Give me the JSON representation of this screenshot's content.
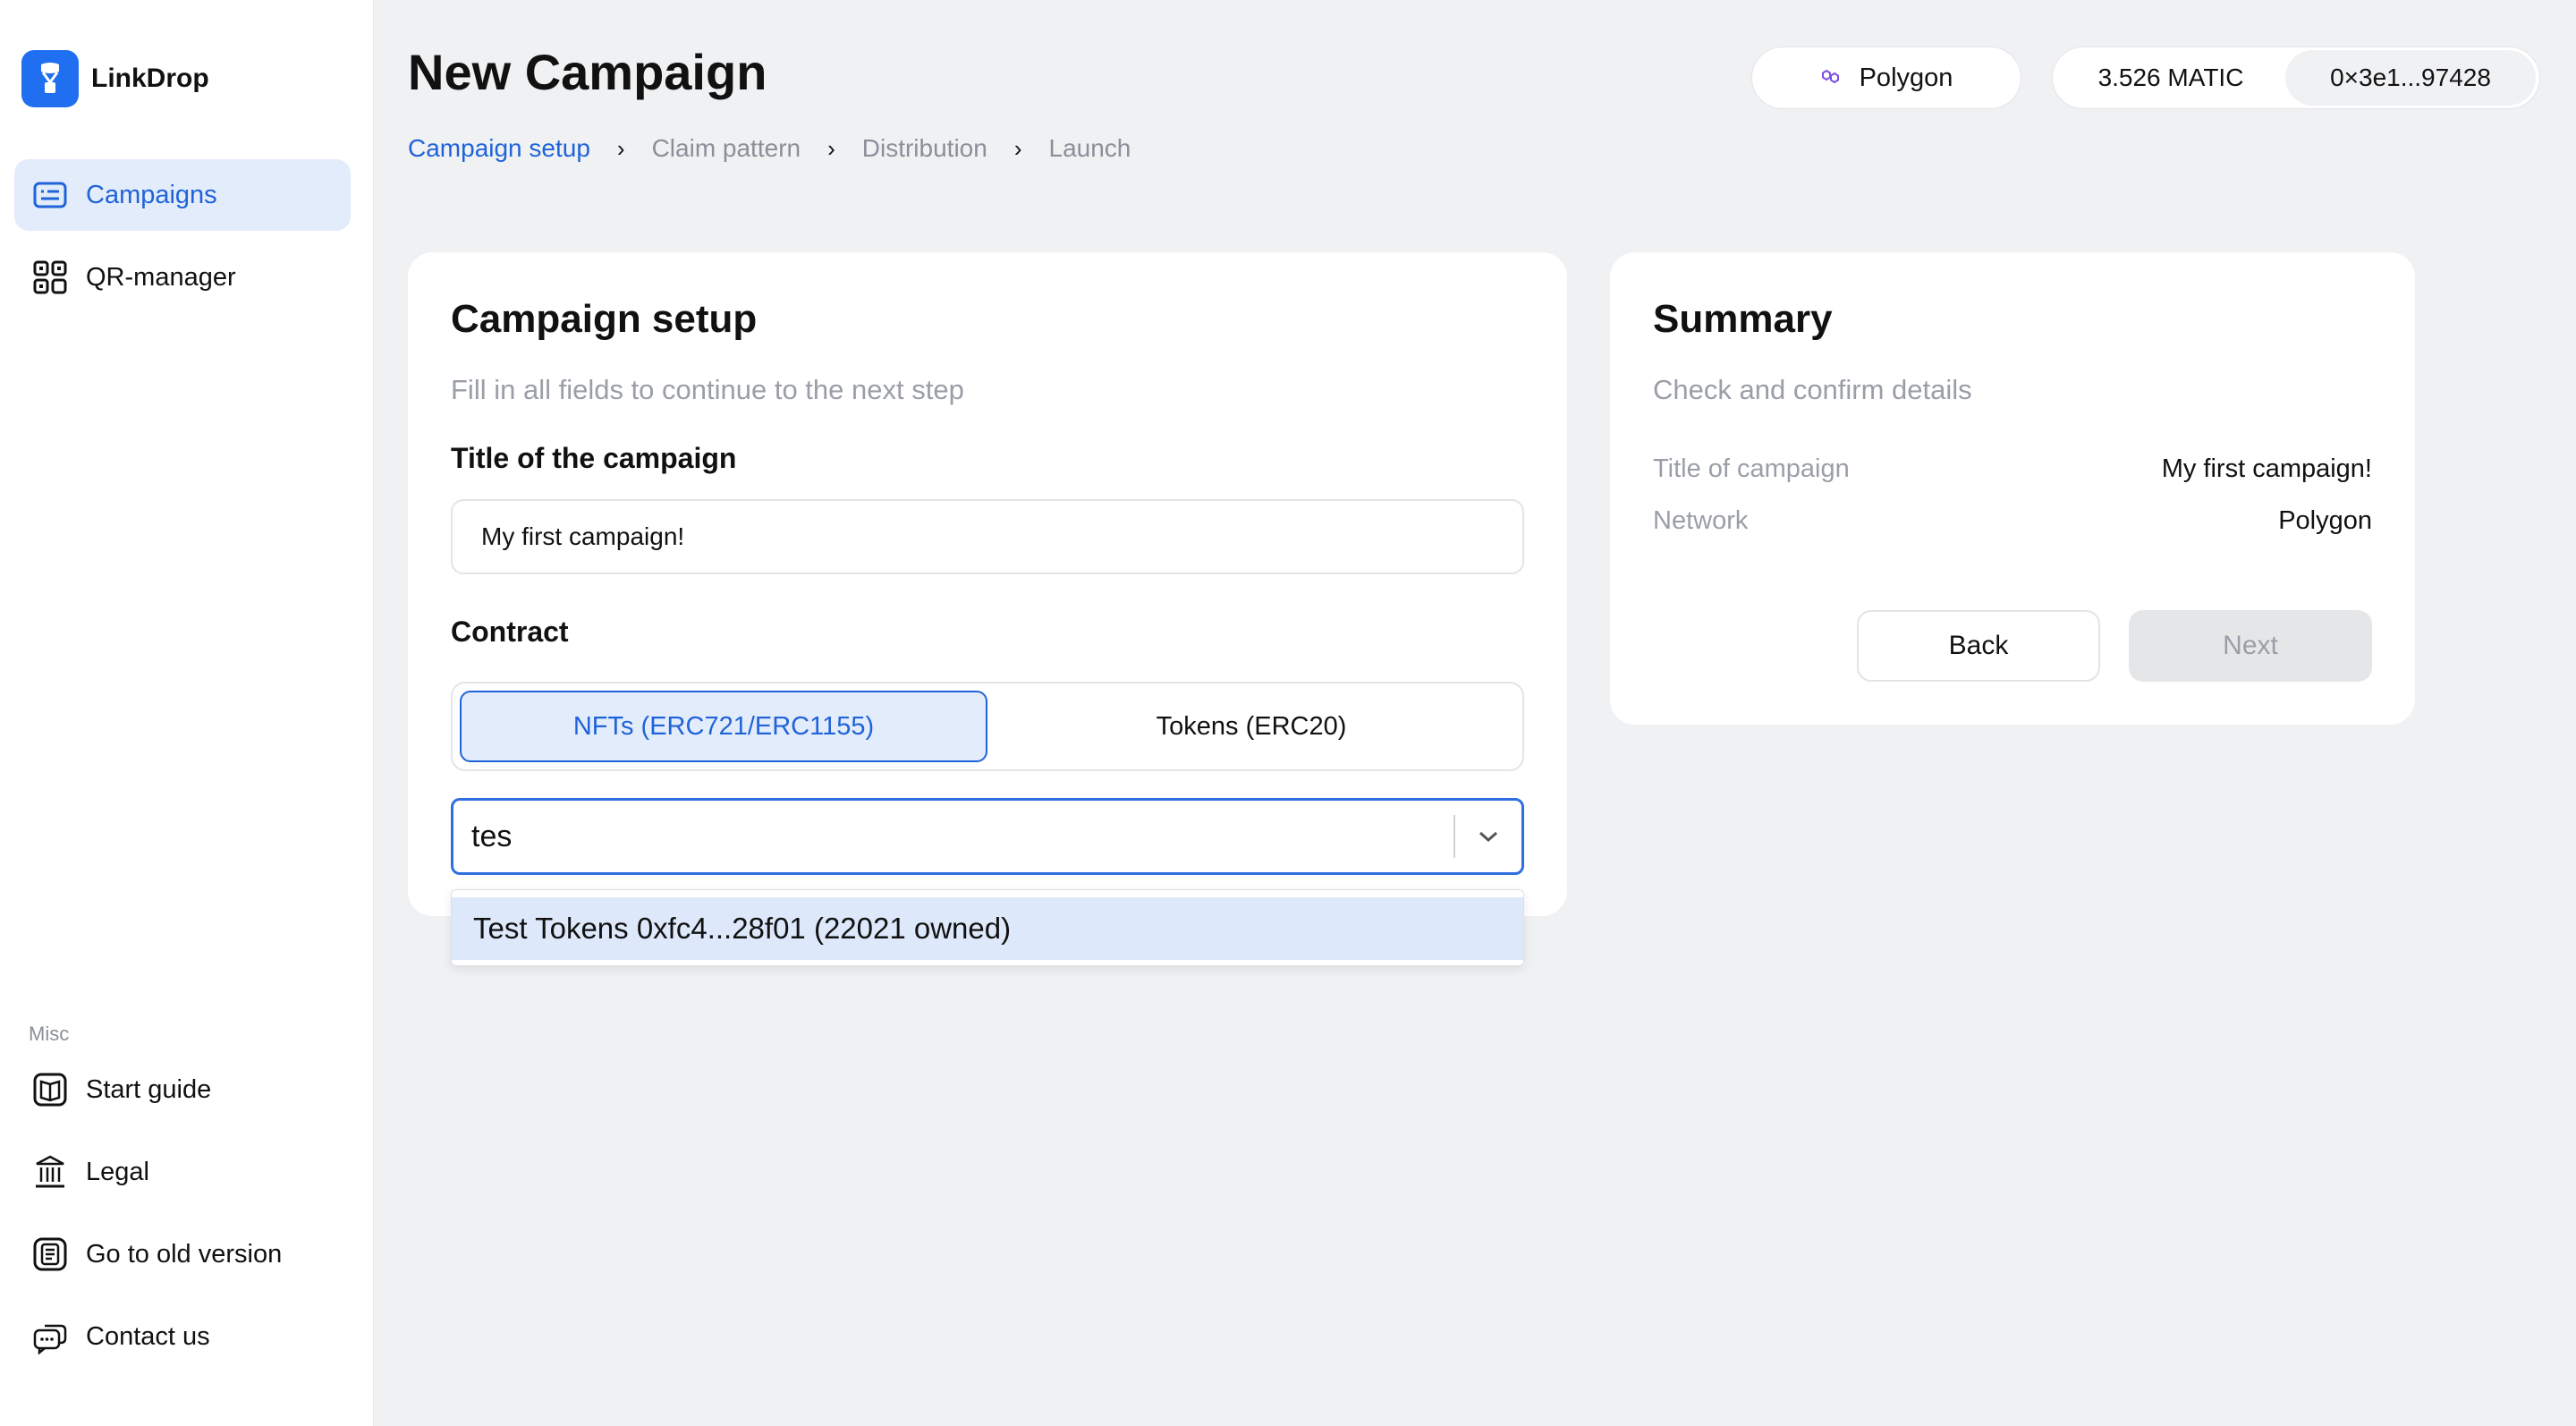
{
  "app": {
    "name": "LinkDrop"
  },
  "sidebar": {
    "items": [
      {
        "label": "Campaigns",
        "icon": "campaigns-icon",
        "active": true
      },
      {
        "label": "QR-manager",
        "icon": "qr-icon",
        "active": false
      }
    ],
    "misc_label": "Misc",
    "misc_items": [
      {
        "label": "Start guide",
        "icon": "book-icon"
      },
      {
        "label": "Legal",
        "icon": "bank-icon"
      },
      {
        "label": "Go to old version",
        "icon": "document-icon"
      },
      {
        "label": "Contact us",
        "icon": "chat-icon"
      }
    ]
  },
  "header": {
    "title": "New Campaign",
    "network": "Polygon",
    "balance": "3.526 MATIC",
    "address": "0×3e1...97428"
  },
  "breadcrumb": [
    "Campaign setup",
    "Claim pattern",
    "Distribution",
    "Launch"
  ],
  "setup": {
    "title": "Campaign setup",
    "subtitle": "Fill in all fields to continue to the next step",
    "title_label": "Title of the campaign",
    "title_value": "My first campaign!",
    "contract_label": "Contract",
    "contract_options": [
      "NFTs (ERC721/ERC1155)",
      "Tokens (ERC20)"
    ],
    "search_value": "tes",
    "dropdown_option": "Test Tokens 0xfc4...28f01 (22021 owned)"
  },
  "summary": {
    "title": "Summary",
    "subtitle": "Check and confirm details",
    "rows": [
      {
        "key": "Title of campaign",
        "value": "My first campaign!"
      },
      {
        "key": "Network",
        "value": "Polygon"
      }
    ],
    "back_label": "Back",
    "next_label": "Next"
  },
  "colors": {
    "accent": "#1f63d8",
    "active_bg": "#e3ecfb",
    "background": "#f0f1f3"
  }
}
